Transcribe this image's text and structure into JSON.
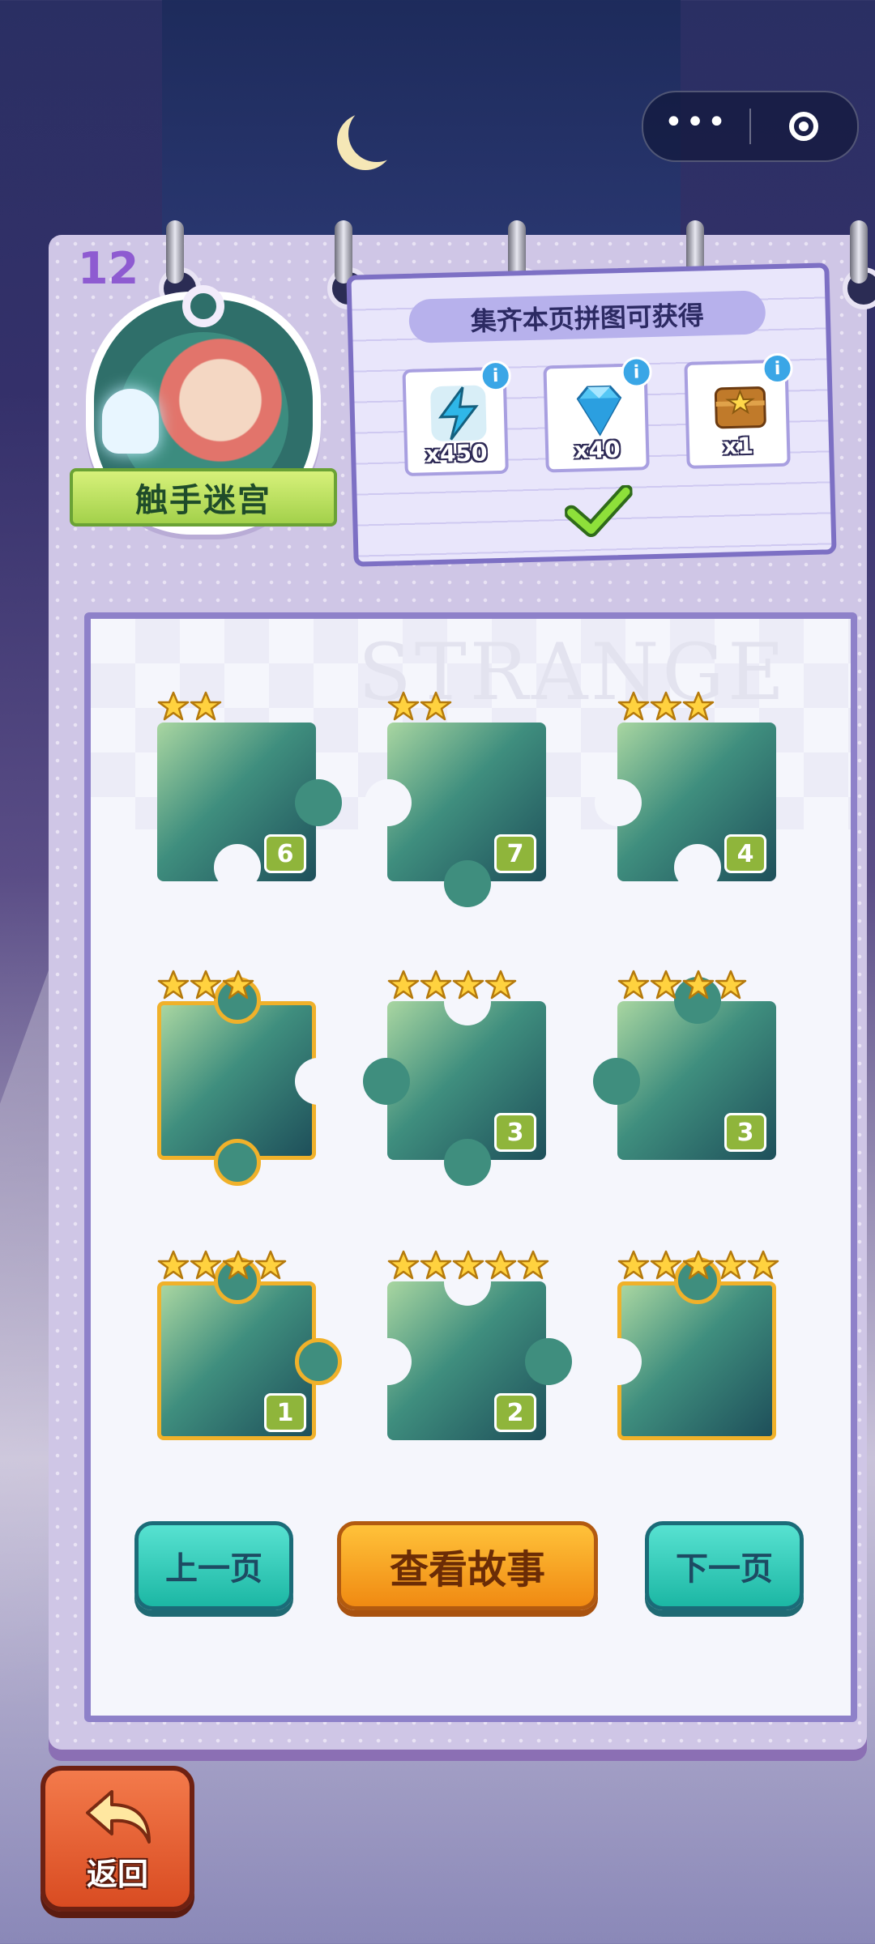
{
  "level": {
    "number": "12",
    "name": "触手迷宫"
  },
  "reward": {
    "title": "集齐本页拼图可获得",
    "items": [
      {
        "icon": "lightning-energy-icon",
        "qty": "x450"
      },
      {
        "icon": "blue-diamond-icon",
        "qty": "x40"
      },
      {
        "icon": "treasure-chest-icon",
        "qty": "x1"
      }
    ],
    "status_icon": "green-check-icon"
  },
  "page": {
    "watermark": "STRANGE"
  },
  "pieces": [
    {
      "num": "6",
      "stars": 2,
      "gold": false
    },
    {
      "num": "7",
      "stars": 2,
      "gold": false
    },
    {
      "num": "4",
      "stars": 3,
      "gold": false
    },
    {
      "num": "",
      "stars": 3,
      "gold": true
    },
    {
      "num": "3",
      "stars": 4,
      "gold": false
    },
    {
      "num": "3",
      "stars": 4,
      "gold": false
    },
    {
      "num": "1",
      "stars": 4,
      "gold": true
    },
    {
      "num": "2",
      "stars": 5,
      "gold": false
    },
    {
      "num": "",
      "stars": 5,
      "gold": true
    }
  ],
  "buttons": {
    "prev": "上一页",
    "story": "查看故事",
    "next": "下一页",
    "back": "返回"
  },
  "colors": {
    "accent_purple": "#8e5bd1",
    "teal": "#1cb7a4",
    "orange": "#f08a12",
    "gold": "#f0b12a",
    "badge_green": "#8fb53b"
  }
}
